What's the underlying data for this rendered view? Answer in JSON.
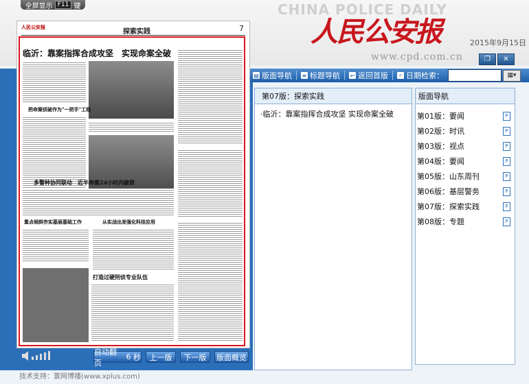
{
  "banner": {
    "fullscreen_label": "全屏显示",
    "fullscreen_key": "F11",
    "fullscreen_suffix": "键",
    "title_en": "CHINA POLICE DAILY",
    "title_cn": "人民公安报",
    "url": "www.cpd.com.cn",
    "date": "2015年9月15日"
  },
  "toolbar": {
    "page_nav": "版面导航",
    "title_nav": "标题导航",
    "back_home": "返回首版",
    "date_search": "日期检索："
  },
  "paper": {
    "section": "探索实践",
    "page_no": "7",
    "headline": "临沂：靠案指挥合成攻坚　实现命案全破",
    "subheads": [
      "把命案侦破作为\"一把手\"工程",
      "多警种协同联动　近半命案24小时内破获",
      "重点倾斜夯实基层基础工作",
      "从实战出发强化科技应用",
      "打造过硬刑侦专业队伍"
    ]
  },
  "controls": {
    "auto_flip": "自动翻页",
    "auto_flip_seconds": "6",
    "seconds_unit": "秒",
    "prev": "上一版",
    "next": "下一版",
    "overview": "版面概览"
  },
  "footer": "技术支持：寰网博播(www.xplus.com)",
  "mid_panel": {
    "header": "第07版：探索实践",
    "articles": [
      "·临沂：靠案指挥合成攻坚 实现命案全破"
    ]
  },
  "right_panel": {
    "header": "版面导航",
    "items": [
      {
        "label": "第01版：要闻"
      },
      {
        "label": "第02版：时讯"
      },
      {
        "label": "第03版：视点"
      },
      {
        "label": "第04版：要闻"
      },
      {
        "label": "第05版：山东周刊"
      },
      {
        "label": "第06版：基层警务"
      },
      {
        "label": "第07版：探索实践"
      },
      {
        "label": "第08版：专题"
      }
    ]
  },
  "icons": [
    "page-nav-icon",
    "title-nav-icon",
    "back-icon",
    "search-icon",
    "calendar-icon",
    "restore-icon",
    "close-icon",
    "speaker-icon",
    "pdf-icon"
  ],
  "colors": {
    "brand_red": "#c8161d",
    "toolbar_blue": "#1c5ea8",
    "frame_red": "#d9141b"
  }
}
